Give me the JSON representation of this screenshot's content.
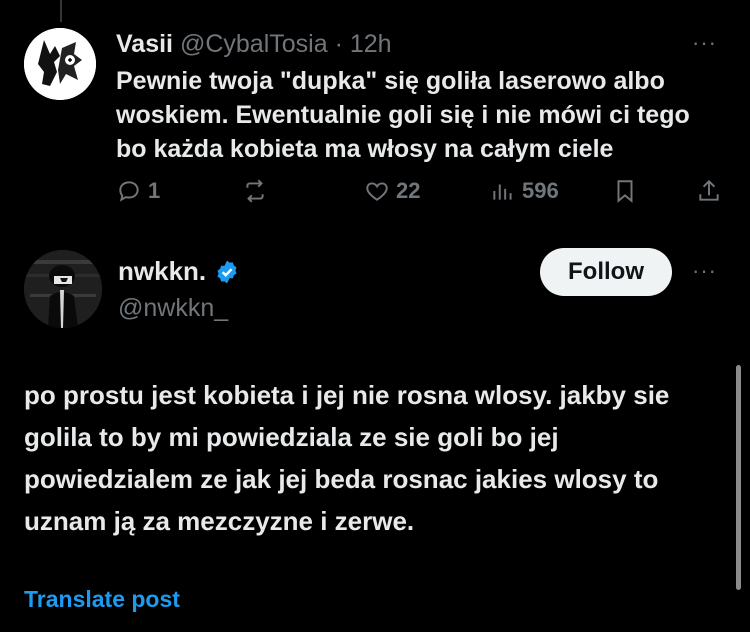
{
  "reply": {
    "author_name": "Vasii",
    "author_handle": "@CybalTosia",
    "separator": "·",
    "time": "12h",
    "more": "···",
    "text": "Pewnie twoja \"dupka\" się goliła laserowo albo woskiem. Ewentualnie goli się i nie mówi ci tego bo każda kobieta ma włosy na całym ciele",
    "stats": {
      "replies": "1",
      "likes": "22",
      "views": "596"
    }
  },
  "post": {
    "author_name": "nwkkn.",
    "author_handle": "@nwkkn_",
    "verified": true,
    "follow_label": "Follow",
    "more": "···",
    "text": "po prostu jest kobieta i jej nie rosna wlosy. jakby sie golila to by mi powiedziala ze sie goli bo jej powiedzialem ze jak jej beda rosnac jakies wlosy to uznam ją za mezczyzne i zerwe.",
    "translate_label": "Translate post"
  },
  "colors": {
    "background": "#000000",
    "text": "#e7e9ea",
    "muted": "#71767b",
    "accent": "#1d9bf0",
    "button_bg": "#eff3f4"
  }
}
